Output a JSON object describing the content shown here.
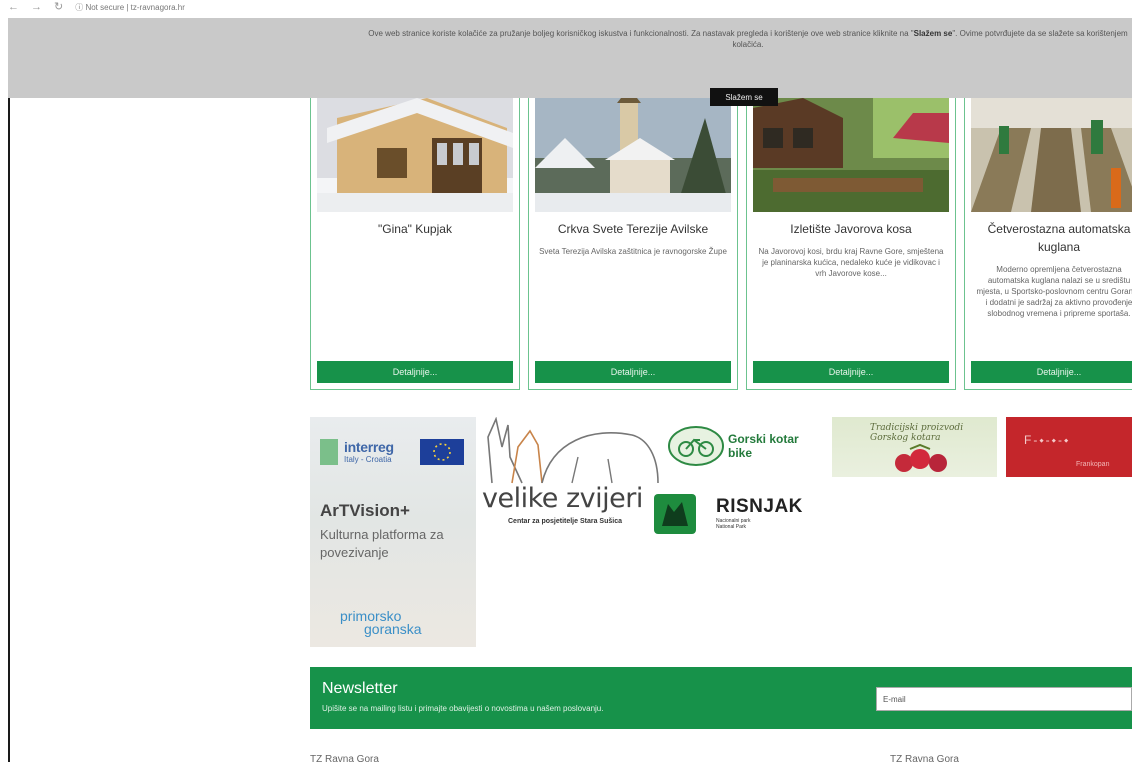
{
  "browser": {
    "back_icon": "arrow-left-icon",
    "forward_icon": "arrow-right-icon",
    "reload_icon": "reload-icon",
    "security_label": "Not secure",
    "url": "tz-ravnagora.hr"
  },
  "cookie": {
    "text_part1": "Ove web stranice koriste kolačiće za pružanje boljeg korisničkog iskustva i funkcionalnosti. Za nastavak pregleda i korištenje ove web stranice kliknite na \"",
    "text_bold": "Slažem se",
    "text_part2": "\". Ovime potvrđujete da se slažete sa korištenjem kolačića.",
    "button_label": "Slažem se"
  },
  "cards": [
    {
      "title": "\"Gina\" Kupjak",
      "desc": "",
      "button": "Detaljnije..."
    },
    {
      "title": "Crkva Svete Terezije Avilske",
      "desc": "Sveta Terezija Avilska zaštitnica je ravnogorske Župe",
      "button": "Detaljnije..."
    },
    {
      "title": "Izletište Javorova kosa",
      "desc": "Na Javorovoj kosi, brdu kraj Ravne Gore, smještena je planinarska kućica, nedaleko kuće je vidikovac i vrh Javorove kose...",
      "button": "Detaljnije..."
    },
    {
      "title": "Četverostazna automatska kuglana",
      "desc": "Moderno opremljena četverostazna automatska kuglana nalazi se u središtu mjesta, u Sportsko-poslovnom centru Goranka i dodatni je sadržaj za aktivno provođenje slobodnog vremena i pripreme sportaša.",
      "button": "Detaljnije..."
    }
  ],
  "logos": {
    "interreg_title": "interreg",
    "interreg_sub": "Italy - Croatia",
    "artvision_title": "ArTVision+",
    "artvision_sub": "Kulturna platforma za povezivanje",
    "primorsko_l1": "primorsko",
    "primorsko_l2": "goranska",
    "zvijeri": "velike zvijeri",
    "zvijeri_sub": "Centar za posjetitelje Stara Sušica",
    "gorski_kotar_l1": "Gorski kotar",
    "gorski_kotar_l2": "bike",
    "risnjak": "RISNJAK",
    "risnjak_sub_l1": "Nacionalni park",
    "risnjak_sub_l2": "National Park",
    "chocolate_l1": "Tradicijski proizvodi",
    "chocolate_l2": "Gorskog kotara",
    "frankopan_title": "F-⬩-⬩-⬩",
    "frankopan_sub": "Frankopan"
  },
  "newsletter": {
    "title": "Newsletter",
    "subtitle": "Upišite se na mailing listu i primajte obavijesti o novostima u našem poslovanju.",
    "email_placeholder": "E-mail"
  },
  "footer": {
    "left": "TZ Ravna Gora",
    "right": "TZ Ravna Gora"
  }
}
